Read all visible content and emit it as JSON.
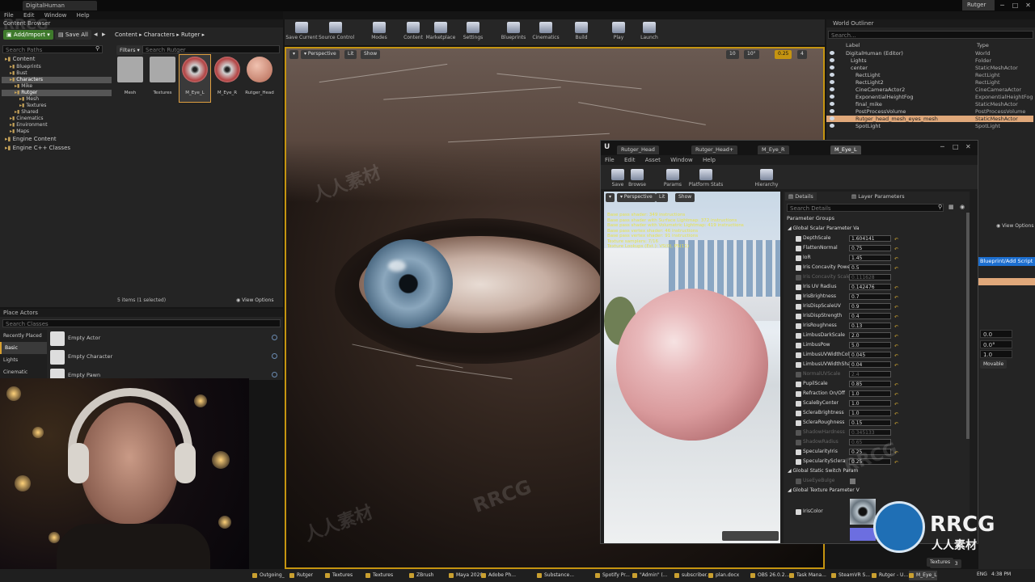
{
  "titlebar": {
    "tab": "DigitalHuman",
    "user": "Rutger"
  },
  "menubar": [
    "File",
    "Edit",
    "Window",
    "Help"
  ],
  "content_browser": {
    "title": "Content Browser",
    "add_import": "Add/Import",
    "save_all": "Save All",
    "breadcrumb": [
      "Content",
      "Characters",
      "Rutger"
    ],
    "search_paths_placeholder": "Search Paths",
    "filters": "Filters",
    "search_placeholder": "Search Rutger",
    "tree": [
      {
        "label": "Content",
        "depth": 0
      },
      {
        "label": "Blueprints",
        "depth": 1
      },
      {
        "label": "Bust",
        "depth": 1
      },
      {
        "label": "Characters",
        "depth": 1,
        "selected": true
      },
      {
        "label": "Mike",
        "depth": 2
      },
      {
        "label": "Rutger",
        "depth": 2,
        "selected": true
      },
      {
        "label": "Mesh",
        "depth": 3
      },
      {
        "label": "Textures",
        "depth": 3
      },
      {
        "label": "Shared",
        "depth": 2
      },
      {
        "label": "Cinematics",
        "depth": 1
      },
      {
        "label": "Environment",
        "depth": 1
      },
      {
        "label": "Maps",
        "depth": 1
      },
      {
        "label": "Engine Content",
        "depth": 0
      },
      {
        "label": "Engine C++ Classes",
        "depth": 0
      }
    ],
    "assets": [
      "Mesh",
      "Textures",
      "M_Eye_L",
      "M_Eye_R",
      "Rutger_Head"
    ],
    "status": "5 items (1 selected)",
    "view_options": "View Options"
  },
  "place_actors": {
    "title": "Place Actors",
    "search_placeholder": "Search Classes",
    "categories": [
      "Recently Placed",
      "Basic",
      "Lights",
      "Cinematic"
    ],
    "items": [
      "Empty Actor",
      "Empty Character",
      "Empty Pawn"
    ]
  },
  "toolbar": [
    "Save Current",
    "Source Control",
    "Modes",
    "Content",
    "Marketplace",
    "Settings",
    "Blueprints",
    "Cinematics",
    "Build",
    "Play",
    "Launch"
  ],
  "viewport": {
    "chips": [
      "Perspective",
      "Lit",
      "Show"
    ],
    "right_values": [
      "10",
      "10°",
      "0.25",
      "4"
    ]
  },
  "world_outliner": {
    "title": "World Outliner",
    "search_placeholder": "Search...",
    "columns": [
      "Label",
      "Type"
    ],
    "rows": [
      {
        "label": "DigitalHuman (Editor)",
        "type": "World"
      },
      {
        "label": "Lights",
        "type": "Folder"
      },
      {
        "label": "center",
        "type": "StaticMeshActor"
      },
      {
        "label": "RectLight",
        "type": "RectLight"
      },
      {
        "label": "RectLight2",
        "type": "RectLight"
      },
      {
        "label": "CineCameraActor2",
        "type": "CineCameraActor"
      },
      {
        "label": "ExponentialHeightFog",
        "type": "ExponentialHeightFog"
      },
      {
        "label": "final_mike",
        "type": "StaticMeshActor"
      },
      {
        "label": "PostProcessVolume",
        "type": "PostProcessVolume"
      },
      {
        "label": "Rutger_head_mesh_eyes_mesh",
        "type": "StaticMeshActor",
        "selected": true
      },
      {
        "label": "SpotLight",
        "type": "SpotLight"
      }
    ]
  },
  "right_panel": {
    "view_options": "View Options",
    "blueprint_btn": "Blueprint/Add Script",
    "movable": "Movable",
    "values": [
      "0.0",
      "0.0°",
      "1.0"
    ],
    "element": "Element 3",
    "textures": "Textures"
  },
  "material_editor": {
    "tabs": [
      "Rutger_Head",
      "Rutger_Head+",
      "M_Eye_R",
      "M_Eye_L"
    ],
    "menu": [
      "File",
      "Edit",
      "Asset",
      "Window",
      "Help"
    ],
    "toolbar": [
      "Save",
      "Browse",
      "Params",
      "Platform Stats",
      "Hierarchy"
    ],
    "preview_chips": [
      "Perspective",
      "Lit",
      "Show"
    ],
    "stats": [
      "Base pass shader: 349 instructions",
      "Base pass shader with Surface Lightmap: 372 instructions",
      "Base pass shader with Volumetric Lightmap: 419 instructions",
      "Base pass vertex shader: 46 instructions",
      "Base pass vertex shader: 91 instructions",
      "Texture samplers: 7/16",
      "Texture Lookups (Est.): VS(0), PS(11)"
    ],
    "details_tab": "Details",
    "layer_tab": "Layer Parameters",
    "search_placeholder": "Search Details",
    "parameter_groups": "Parameter Groups",
    "scalar_group": "Global Scalar Parameter Va",
    "params": [
      {
        "name": "DepthScale",
        "value": "1.604141",
        "enabled": true
      },
      {
        "name": "FlattenNormal",
        "value": "0.75",
        "enabled": true
      },
      {
        "name": "IoR",
        "value": "1.45",
        "enabled": true
      },
      {
        "name": "Iris Concavity Power",
        "value": "0.5",
        "enabled": true
      },
      {
        "name": "Iris Concavity Scale",
        "value": "0.111628",
        "enabled": false
      },
      {
        "name": "Iris UV Radius",
        "value": "0.142476",
        "enabled": true
      },
      {
        "name": "IrisBrightness",
        "value": "0.7",
        "enabled": true
      },
      {
        "name": "IrisDispScaleUV",
        "value": "0.9",
        "enabled": true
      },
      {
        "name": "IrisDispStrength",
        "value": "0.4",
        "enabled": true
      },
      {
        "name": "IrisRoughness",
        "value": "0.13",
        "enabled": true
      },
      {
        "name": "LimbusDarkScale",
        "value": "2.0",
        "enabled": true
      },
      {
        "name": "LimbusPow",
        "value": "5.0",
        "enabled": true
      },
      {
        "name": "LimbusUVWidthColor",
        "value": "0.045",
        "enabled": true
      },
      {
        "name": "LimbusUVWidthShading",
        "value": "0.04",
        "enabled": true
      },
      {
        "name": "NormalUVScale",
        "value": "2.4",
        "enabled": false
      },
      {
        "name": "PupilScale",
        "value": "0.85",
        "enabled": true
      },
      {
        "name": "Refraction On/Off",
        "value": "1.0",
        "enabled": true
      },
      {
        "name": "ScaleByCenter",
        "value": "1.0",
        "enabled": true
      },
      {
        "name": "ScleraBrightness",
        "value": "1.0",
        "enabled": true
      },
      {
        "name": "ScleraRoughness",
        "value": "0.15",
        "enabled": true
      },
      {
        "name": "ShadowHardness",
        "value": "0.345133",
        "enabled": false
      },
      {
        "name": "ShadowRadius",
        "value": "0.65",
        "enabled": false
      },
      {
        "name": "SpecularityIris",
        "value": "0.25",
        "enabled": true
      },
      {
        "name": "SpecularitySclera",
        "value": "0.25",
        "enabled": true
      }
    ],
    "static_group": "Global Static Switch Param",
    "use_eye_bulge": "UseEyeBulge",
    "texture_group": "Global Texture Parameter V",
    "iris_color": "IrisColor"
  },
  "taskbar": {
    "items": [
      "Outgoing_",
      "Rutger",
      "Textures",
      "Textures",
      "ZBrush",
      "Maya 2020",
      "Adobe Ph...",
      "Substance...",
      "Spotify Pr...",
      "\"Admin\" (...",
      "subscriber...",
      "plan.docx",
      "OBS 26.0.2...",
      "Task Mana...",
      "SteamVR S...",
      "Rutger - U...",
      "M_Eye_L"
    ],
    "lang": "ENG",
    "time": "4:38 PM"
  },
  "watermark": {
    "text": "RRCG",
    "sub": "人人素材"
  },
  "colors": {
    "accent": "#c59410",
    "selected_row": "#e0a87a",
    "add_import": "#3e7a2c",
    "stats_text": "#e7e24a"
  }
}
